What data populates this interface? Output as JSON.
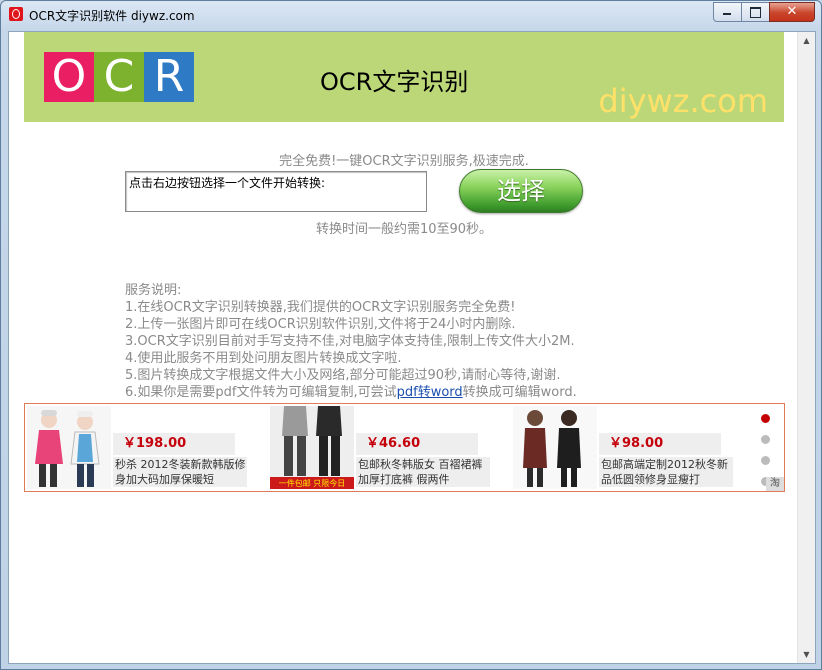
{
  "window": {
    "title": "OCR文字识别软件 diywz.com",
    "close_label": "✕"
  },
  "banner": {
    "logo_letters": [
      "O",
      "C",
      "R"
    ],
    "logo_colors": [
      "#e91e63",
      "#7cb22e",
      "#2f7ac4"
    ],
    "title": "OCR文字识别",
    "site": "diywz.com"
  },
  "main": {
    "subtitle": "完全免费!一键OCR文字识别服务,极速完成.",
    "file_field_value": "点击右边按钮选择一个文件开始转换:",
    "select_button": "选择",
    "time_note": "转换时间一般约需10至90秒。"
  },
  "notes": {
    "heading": "服务说明:",
    "lines": [
      "1.在线OCR文字识别转换器,我们提供的OCR文字识别服务完全免费!",
      "2.上传一张图片即可在线OCR识别软件识别,文件将于24小时内删除.",
      "3.OCR文字识别目前对手写支持不佳,对电脑字体支持佳,限制上传文件大小2M.",
      "4.使用此服务不用到处问朋友图片转换成文字啦.",
      "5.图片转换成文字根据文件大小及网络,部分可能超过90秒,请耐心等待,谢谢."
    ],
    "line6_before": "6.如果你是需要pdf文件转为可编辑复制,可尝试",
    "line6_link": "pdf转word",
    "line6_after": "转换成可编辑word."
  },
  "ads": [
    {
      "price": "￥198.00",
      "desc": "秒杀 2012冬装新款韩版修身加大码加厚保暖短"
    },
    {
      "price": "￥46.60",
      "desc": "包邮秋冬韩版女 百褶裙裤 加厚打底裤 假两件",
      "badge": "一件包邮 只限今日"
    },
    {
      "price": "￥98.00",
      "desc": "包邮高端定制2012秋冬新品低圆领修身显瘦打"
    }
  ],
  "ads_footer": {
    "taobao_label": "淘"
  }
}
